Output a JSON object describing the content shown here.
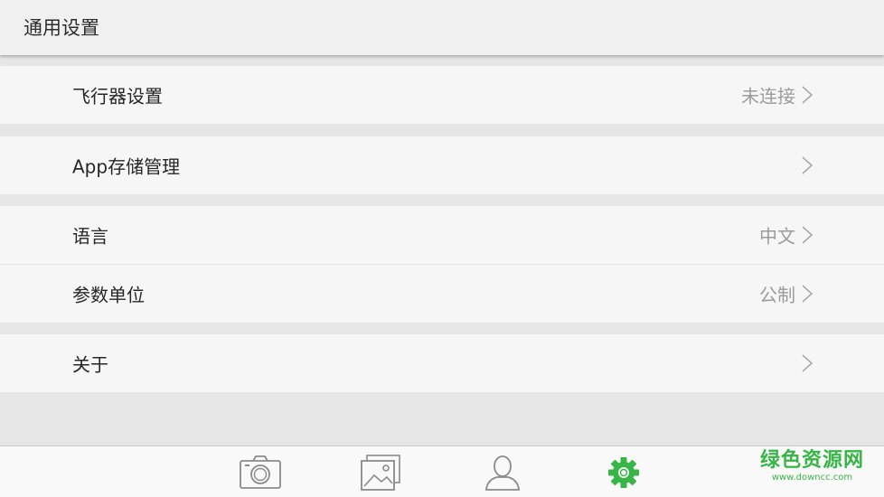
{
  "header": {
    "title": "通用设置"
  },
  "settings": {
    "items": [
      {
        "label": "飞行器设置",
        "value": "未连接"
      },
      {
        "label": "App存储管理",
        "value": ""
      },
      {
        "label": "语言",
        "value": "中文"
      },
      {
        "label": "参数单位",
        "value": "公制"
      },
      {
        "label": "关于",
        "value": ""
      }
    ]
  },
  "tabbar": {
    "tabs": [
      {
        "icon": "camera-icon",
        "active": false
      },
      {
        "icon": "gallery-icon",
        "active": false
      },
      {
        "icon": "user-icon",
        "active": false
      },
      {
        "icon": "gear-icon",
        "active": true
      }
    ]
  },
  "watermark": {
    "title": "绿色资源网",
    "url": "www.downcc.com"
  },
  "colors": {
    "accent": "#37b546",
    "inactive_icon": "#8a8a8a",
    "row_background": "#f6f6f6",
    "page_background": "#e6e6e6"
  }
}
